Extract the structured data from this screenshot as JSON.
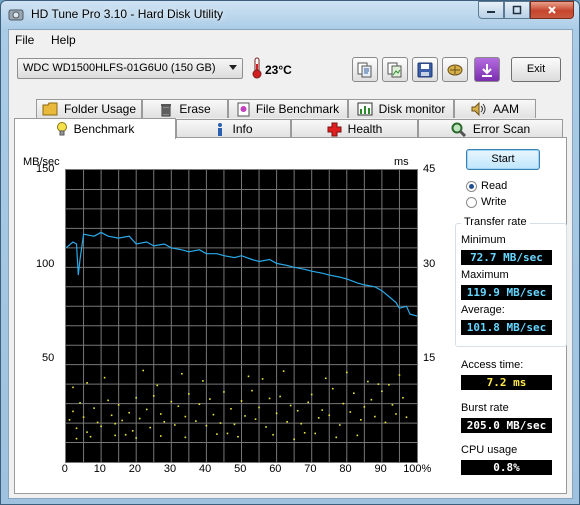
{
  "window": {
    "title": "HD Tune Pro 3.10 - Hard Disk Utility"
  },
  "menu": {
    "file": "File",
    "help": "Help"
  },
  "toolbar": {
    "drive": "WDC WD1500HLFS-01G6U0 (150 GB)",
    "temperature": "23°C",
    "exit_label": "Exit",
    "buttons": [
      "copy-info-icon",
      "copy-screenshot-icon",
      "save-icon",
      "options-icon",
      "download-icon"
    ]
  },
  "tabs_top": [
    {
      "label": "Folder Usage",
      "icon": "folder-icon"
    },
    {
      "label": "Erase",
      "icon": "trash-icon"
    },
    {
      "label": "File Benchmark",
      "icon": "file-benchmark-icon"
    },
    {
      "label": "Disk monitor",
      "icon": "disk-monitor-icon"
    },
    {
      "label": "AAM",
      "icon": "speaker-icon"
    }
  ],
  "tabs_bottom": [
    {
      "label": "Benchmark",
      "icon": "lightbulb-icon",
      "active": true
    },
    {
      "label": "Info",
      "icon": "info-icon"
    },
    {
      "label": "Health",
      "icon": "health-cross-icon"
    },
    {
      "label": "Error Scan",
      "icon": "magnifier-icon"
    }
  ],
  "controls": {
    "start_label": "Start",
    "read_label": "Read",
    "write_label": "Write",
    "mode_selected": "Read"
  },
  "stats": {
    "transfer_rate_title": "Transfer rate",
    "minimum_label": "Minimum",
    "minimum_value": "72.7 MB/sec",
    "maximum_label": "Maximum",
    "maximum_value": "119.9 MB/sec",
    "average_label": "Average:",
    "average_value": "101.8 MB/sec",
    "access_time_label": "Access time:",
    "access_time_value": "7.2 ms",
    "burst_rate_label": "Burst rate",
    "burst_rate_value": "205.0 MB/sec",
    "cpu_usage_label": "CPU usage",
    "cpu_usage_value": "0.8%"
  },
  "chart_data": {
    "type": "line",
    "left_unit": "MB/sec",
    "right_unit": "ms",
    "left_ticks": [
      "150",
      "100",
      "50"
    ],
    "right_ticks": [
      "45",
      "30",
      "15"
    ],
    "x_ticks": [
      "0",
      "10",
      "20",
      "30",
      "40",
      "50",
      "60",
      "70",
      "80",
      "90",
      "100%"
    ],
    "xlim": [
      0,
      100
    ],
    "ylim": [
      0,
      150
    ],
    "y2lim": [
      0,
      45
    ],
    "grid": true,
    "colors": {
      "transfer": "#2aa9e8",
      "access": "#e8e83a",
      "background": "#000000",
      "grid": "#777777"
    },
    "series": [
      {
        "name": "Transfer rate",
        "x": [
          0,
          2,
          3,
          3.5,
          4,
          5,
          8,
          10,
          12,
          15,
          18,
          20,
          23,
          25,
          28,
          30,
          33,
          35,
          38,
          40,
          43,
          45,
          48,
          50,
          53,
          55,
          58,
          60,
          63,
          65,
          68,
          70,
          73,
          75,
          78,
          80,
          83,
          85,
          88,
          90,
          92,
          94,
          95,
          97,
          98,
          100
        ],
        "values": [
          110,
          113,
          112,
          96,
          104,
          117,
          116,
          118,
          116,
          115,
          116,
          112,
          113,
          111,
          112,
          110,
          109,
          108,
          109,
          107,
          107,
          106,
          105,
          106,
          104,
          103,
          104,
          102,
          101,
          100,
          99,
          98,
          97,
          96,
          95,
          94,
          92,
          91,
          90,
          88,
          85,
          82,
          79,
          80,
          76,
          75
        ]
      },
      {
        "name": "Access time",
        "x": [
          1,
          2,
          3,
          4,
          5,
          6,
          8,
          9,
          10,
          12,
          13,
          14,
          15,
          16,
          18,
          19,
          20,
          21,
          23,
          24,
          25,
          27,
          28,
          30,
          31,
          32,
          34,
          35,
          37,
          38,
          40,
          41,
          42,
          44,
          45,
          47,
          48,
          50,
          51,
          53,
          54,
          55,
          57,
          58,
          60,
          61,
          63,
          64,
          66,
          67,
          69,
          70,
          72,
          73,
          75,
          76,
          78,
          79,
          81,
          82,
          84,
          85,
          87,
          88,
          90,
          91,
          93,
          94,
          96,
          97,
          2,
          6,
          11,
          17,
          22,
          26,
          33,
          39,
          46,
          52,
          56,
          62,
          68,
          74,
          80,
          86,
          92,
          95,
          3,
          7,
          14,
          20,
          27,
          34,
          43,
          49,
          59,
          65,
          71,
          77,
          83,
          89
        ],
        "values": [
          6.5,
          7.8,
          5.2,
          9.1,
          6.9,
          4.6,
          8.3,
          6.1,
          5.5,
          9.5,
          7.2,
          5.9,
          8.8,
          6.4,
          7.6,
          4.8,
          9.9,
          6.7,
          8.1,
          5.3,
          10.2,
          7.4,
          6.2,
          9.3,
          5.7,
          8.6,
          7.0,
          10.5,
          6.3,
          8.9,
          5.6,
          9.7,
          7.3,
          6.0,
          10.8,
          8.2,
          5.8,
          9.4,
          7.1,
          11.0,
          6.6,
          8.4,
          5.4,
          9.8,
          7.5,
          10.1,
          6.2,
          8.7,
          7.9,
          5.9,
          9.2,
          10.4,
          6.8,
          8.0,
          7.2,
          11.3,
          5.7,
          9.0,
          7.7,
          10.6,
          6.5,
          8.5,
          9.6,
          7.0,
          10.9,
          6.1,
          8.8,
          7.4,
          9.9,
          6.9,
          11.5,
          12.2,
          13.0,
          4.2,
          14.1,
          11.8,
          13.6,
          12.5,
          4.4,
          13.2,
          12.8,
          14.0,
          4.5,
          12.9,
          13.8,
          12.4,
          11.9,
          13.4,
          3.6,
          3.9,
          4.1,
          3.7,
          4.0,
          3.8,
          4.3,
          3.9,
          4.2,
          3.5,
          4.4,
          3.8,
          4.1,
          12.0
        ]
      }
    ]
  }
}
